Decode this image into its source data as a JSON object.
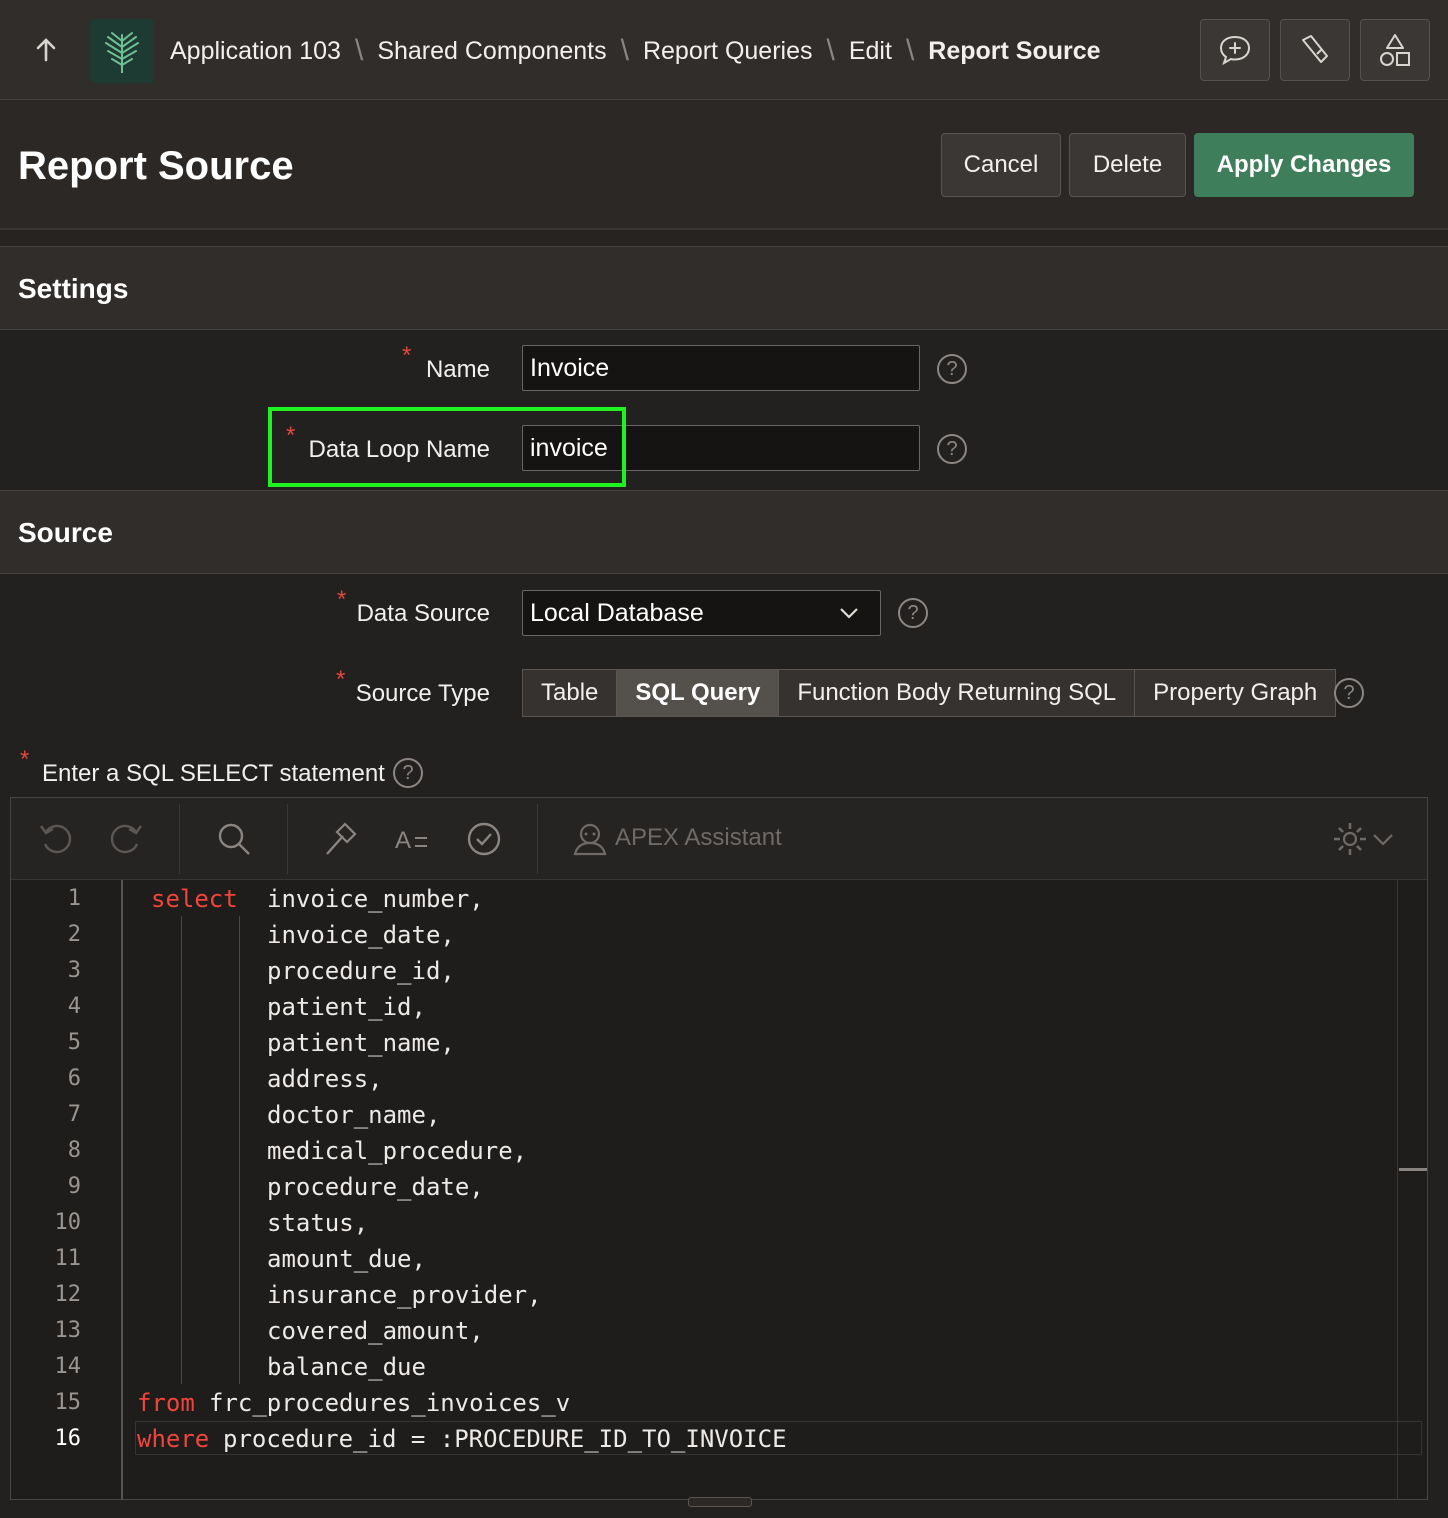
{
  "breadcrumb": [
    "Application 103",
    "Shared Components",
    "Report Queries",
    "Edit",
    "Report Source"
  ],
  "page": {
    "title": "Report Source"
  },
  "actions": {
    "cancel": "Cancel",
    "delete": "Delete",
    "apply": "Apply Changes"
  },
  "settings": {
    "heading": "Settings",
    "name_label": "Name",
    "name_value": "Invoice",
    "loop_label": "Data Loop Name",
    "loop_value": "invoice"
  },
  "source": {
    "heading": "Source",
    "data_source_label": "Data Source",
    "data_source_value": "Local Database",
    "source_type_label": "Source Type",
    "source_types": [
      "Table",
      "SQL Query",
      "Function Body Returning SQL",
      "Property Graph"
    ],
    "active_source_type": "SQL Query",
    "sql_label": "Enter a SQL SELECT statement"
  },
  "editor": {
    "assistant_label": "APEX Assistant",
    "lines": [
      {
        "kw": "select",
        "text": "invoice_number,"
      },
      {
        "kw": "",
        "text": "invoice_date,"
      },
      {
        "kw": "",
        "text": "procedure_id,"
      },
      {
        "kw": "",
        "text": "patient_id,"
      },
      {
        "kw": "",
        "text": "patient_name,"
      },
      {
        "kw": "",
        "text": "address,"
      },
      {
        "kw": "",
        "text": "doctor_name,"
      },
      {
        "kw": "",
        "text": "medical_procedure,"
      },
      {
        "kw": "",
        "text": "procedure_date,"
      },
      {
        "kw": "",
        "text": "status,"
      },
      {
        "kw": "",
        "text": "amount_due,"
      },
      {
        "kw": "",
        "text": "insurance_provider,"
      },
      {
        "kw": "",
        "text": "covered_amount,"
      },
      {
        "kw": "",
        "text": "balance_due"
      },
      {
        "kw": "from",
        "text": "frc_procedures_invoices_v"
      },
      {
        "kw": "where",
        "text": "procedure_id = :PROCEDURE_ID_TO_INVOICE"
      }
    ],
    "current_line": 16
  },
  "colors": {
    "accent": "#3e7e5b",
    "keyword": "#f0453a",
    "highlight": "#1ff21f",
    "required": "#e0483e"
  },
  "icons": [
    "up-arrow-icon",
    "app-logo-icon",
    "feedback-icon",
    "developer-tools-icon",
    "shapes-icon",
    "undo-icon",
    "redo-icon",
    "search-icon",
    "hammer-icon",
    "format-icon",
    "validate-icon",
    "assistant-icon",
    "settings-icon",
    "help-icon",
    "chevron-down-icon"
  ]
}
